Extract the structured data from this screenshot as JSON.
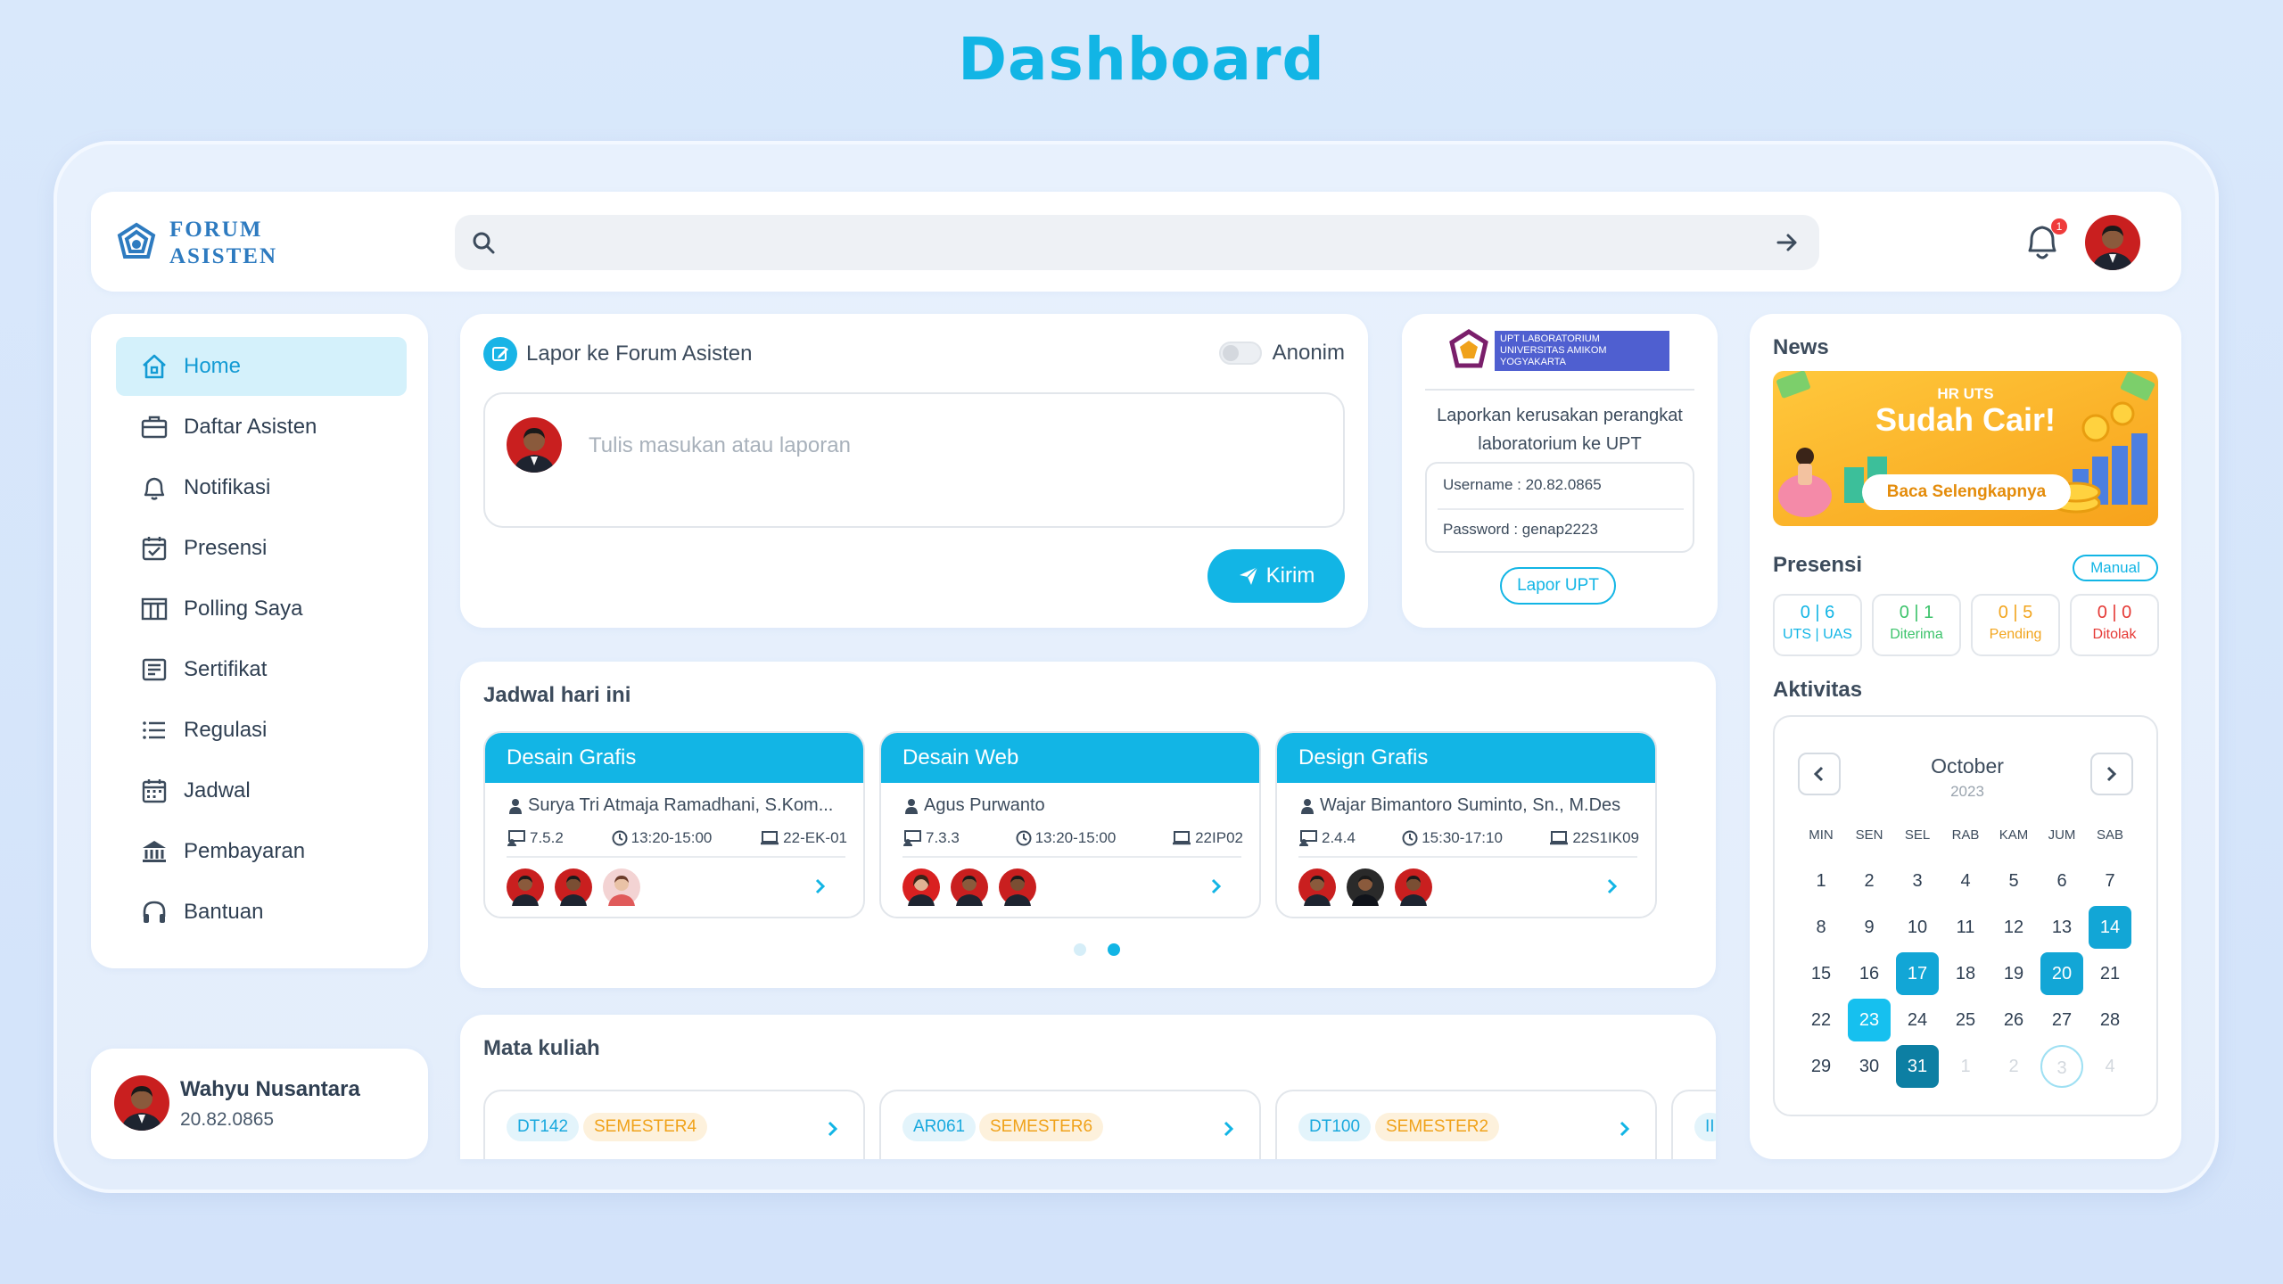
{
  "page_title": "Dashboard",
  "app": {
    "name_line1": "FORUM",
    "name_line2": "ASISTEN"
  },
  "search": {
    "placeholder": "",
    "value": ""
  },
  "notifications": {
    "badge": "1"
  },
  "sidebar": {
    "items": [
      {
        "label": "Home",
        "icon": "home-icon"
      },
      {
        "label": "Daftar Asisten",
        "icon": "briefcase-icon"
      },
      {
        "label": "Notifikasi",
        "icon": "bell-icon"
      },
      {
        "label": "Presensi",
        "icon": "calendar-check-icon"
      },
      {
        "label": "Polling Saya",
        "icon": "columns-icon"
      },
      {
        "label": "Sertifikat",
        "icon": "certificate-icon"
      },
      {
        "label": "Regulasi",
        "icon": "list-icon"
      },
      {
        "label": "Jadwal",
        "icon": "calendar-icon"
      },
      {
        "label": "Pembayaran",
        "icon": "bank-icon"
      },
      {
        "label": "Bantuan",
        "icon": "headphones-icon"
      }
    ]
  },
  "user": {
    "name": "Wahyu Nusantara",
    "nim": "20.82.0865"
  },
  "lapor": {
    "title": "Lapor ke Forum Asisten",
    "anon_label": "Anonim",
    "placeholder": "Tulis masukan atau laporan",
    "send_label": "Kirim"
  },
  "upt": {
    "brand_line1": "UPT LABORATORIUM",
    "brand_line2": "UNIVERSITAS AMIKOM YOGYAKARTA",
    "desc": "Laporkan kerusakan perangkat laboratorium ke UPT",
    "username": "Username : 20.82.0865",
    "password": "Password : genap2223",
    "button": "Lapor UPT"
  },
  "jadwal": {
    "title": "Jadwal hari ini",
    "items": [
      {
        "course": "Desain Grafis",
        "lecturer": "Surya Tri Atmaja Ramadhani, S.Kom...",
        "room": "7.5.2",
        "time": "13:20-15:00",
        "class": "22-EK-01"
      },
      {
        "course": "Desain Web",
        "lecturer": "Agus Purwanto",
        "room": "7.3.3",
        "time": "13:20-15:00",
        "class": "22IP02"
      },
      {
        "course": "Design Grafis",
        "lecturer": "Wajar Bimantoro Suminto, Sn., M.Des",
        "room": "2.4.4",
        "time": "15:30-17:10",
        "class": "22S1IK09"
      }
    ]
  },
  "matkul": {
    "title": "Mata kuliah",
    "items": [
      {
        "code": "DT142",
        "semester": "SEMESTER4"
      },
      {
        "code": "AR061",
        "semester": "SEMESTER6"
      },
      {
        "code": "DT100",
        "semester": "SEMESTER2"
      },
      {
        "code": "II",
        "semester": ""
      }
    ]
  },
  "news": {
    "title": "News",
    "small": "HR UTS",
    "big": "Sudah Cair!",
    "cta": "Baca Selengkapnya"
  },
  "presensi": {
    "title": "Presensi",
    "manual": "Manual",
    "stats": [
      {
        "value": "0 | 6",
        "label": "UTS | UAS",
        "color": "#12b5e5"
      },
      {
        "value": "0 | 1",
        "label": "Diterima",
        "color": "#3cc36b"
      },
      {
        "value": "0 | 5",
        "label": "Pending",
        "color": "#f2a51e"
      },
      {
        "value": "0 | 0",
        "label": "Ditolak",
        "color": "#e53935"
      }
    ]
  },
  "aktivitas": {
    "title": "Aktivitas",
    "month": "October",
    "year": "2023",
    "weekdays": [
      "MIN",
      "SEN",
      "SEL",
      "RAB",
      "KAM",
      "JUM",
      "SAB"
    ],
    "weeks": [
      [
        "1",
        "2",
        "3",
        "4",
        "5",
        "6",
        "7"
      ],
      [
        "8",
        "9",
        "10",
        "11",
        "12",
        "13",
        "14"
      ],
      [
        "15",
        "16",
        "17",
        "18",
        "19",
        "20",
        "21"
      ],
      [
        "22",
        "23",
        "24",
        "25",
        "26",
        "27",
        "28"
      ],
      [
        "29",
        "30",
        "31",
        "1",
        "2",
        "3",
        "4"
      ]
    ]
  },
  "colors": {
    "accent": "#12b5e5",
    "text": "#2f3f52"
  }
}
